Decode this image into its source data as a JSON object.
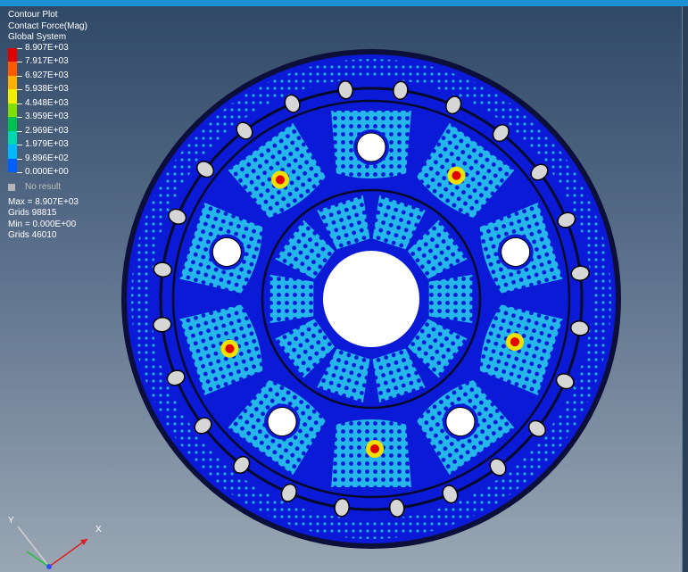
{
  "legend": {
    "title": "Contour Plot",
    "subtitle": "Contact Force(Mag)",
    "system": "Global System",
    "scale": [
      {
        "label": "8.907E+03",
        "color": "#e00000"
      },
      {
        "label": "7.917E+03",
        "color": "#ff5a00"
      },
      {
        "label": "6.927E+03",
        "color": "#ffb000"
      },
      {
        "label": "5.938E+03",
        "color": "#f0f000"
      },
      {
        "label": "4.948E+03",
        "color": "#80e000"
      },
      {
        "label": "3.959E+03",
        "color": "#00c050"
      },
      {
        "label": "2.969E+03",
        "color": "#00d8b0"
      },
      {
        "label": "1.979E+03",
        "color": "#00b8ff"
      },
      {
        "label": "9.896E+02",
        "color": "#0060ff"
      },
      {
        "label": "0.000E+00",
        "color": "#0000c0"
      }
    ],
    "no_result": "No result",
    "max_line": "Max = 8.907E+03",
    "max_grid": "Grids 98815",
    "min_line": "Min = 0.000E+00",
    "min_grid": "Grids 46010"
  },
  "axes": {
    "y_label": "Y",
    "x_label": "X"
  },
  "colors": {
    "background_top": "#2f4866",
    "background_bottom": "#9aa7b4",
    "model_base": "#0b1ad6",
    "contact_mid": "#1aa8e8",
    "contact_high": "#ffe000",
    "contact_peak": "#e00000"
  }
}
